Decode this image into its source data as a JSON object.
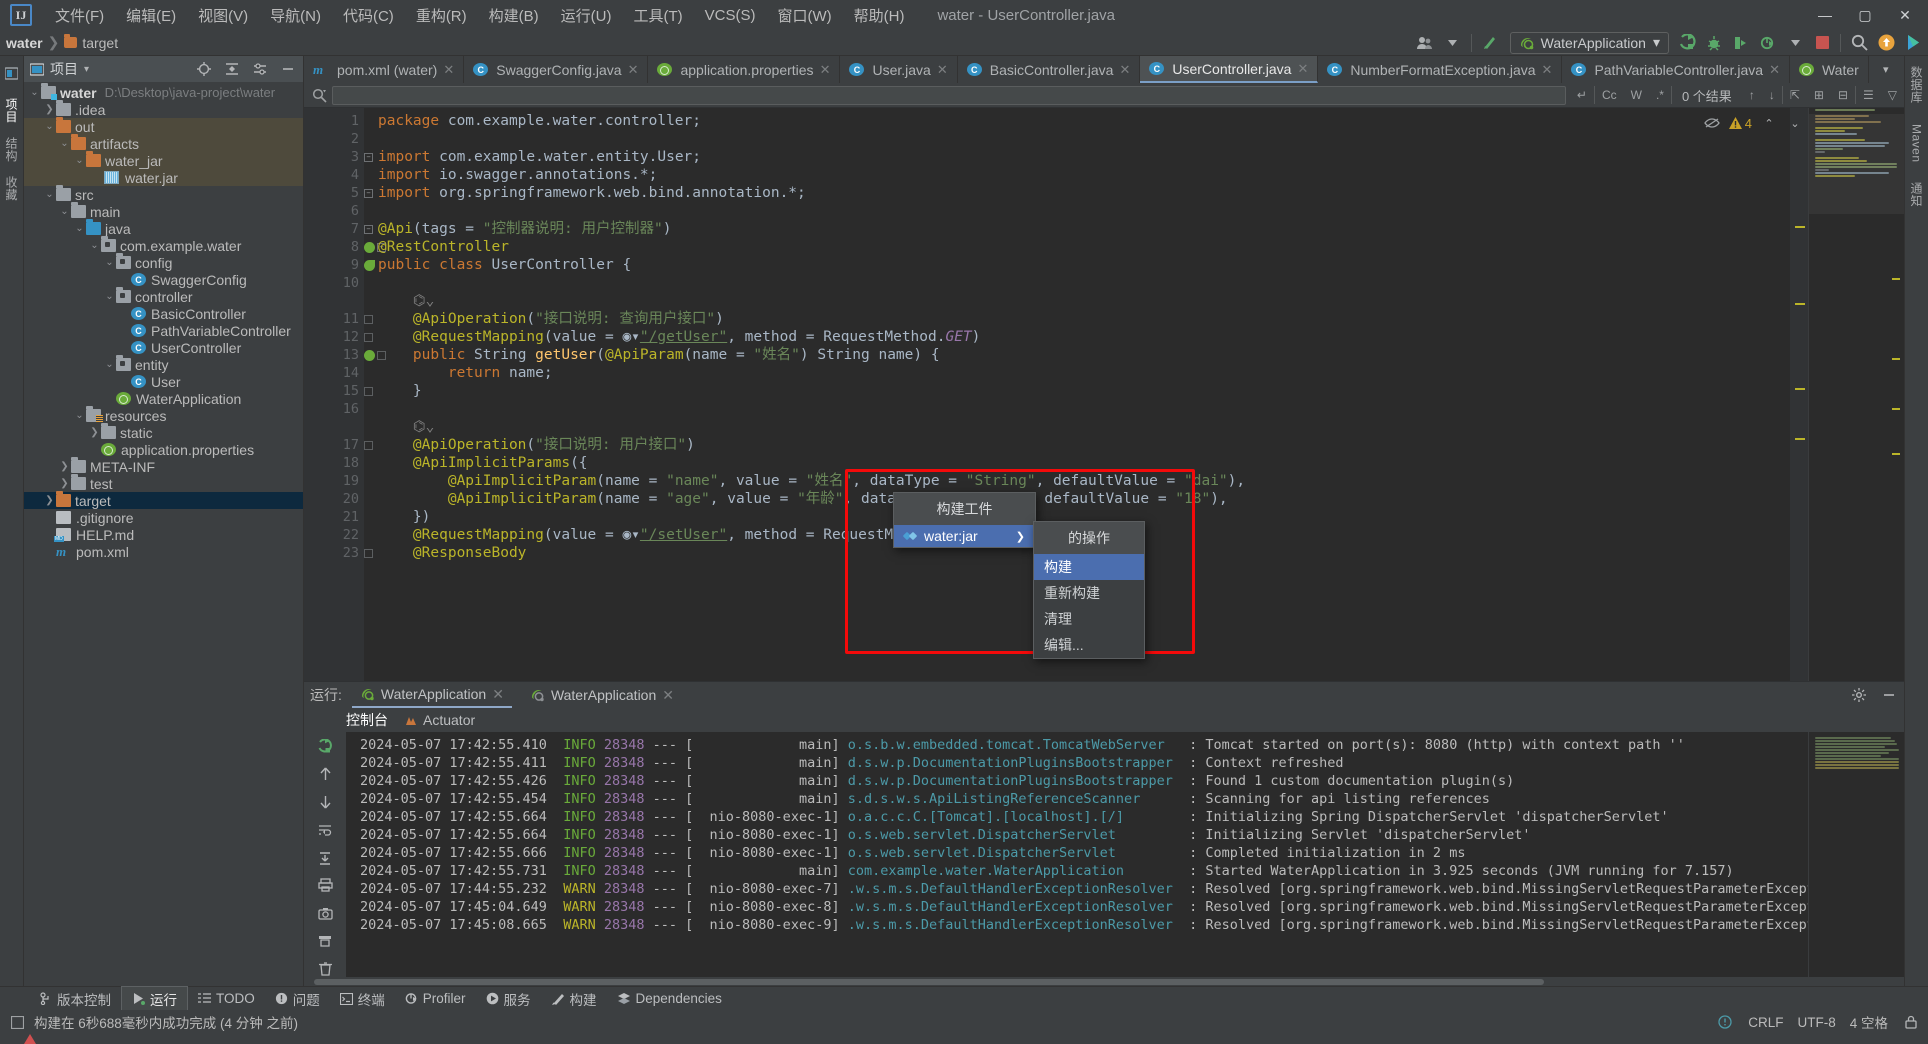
{
  "window": {
    "title": "water - UserController.java",
    "logo_text": "IJ",
    "controls": {
      "minimize": "—",
      "maximize": "▢",
      "close": "✕"
    }
  },
  "menubar": [
    {
      "label": "文件(F)"
    },
    {
      "label": "编辑(E)"
    },
    {
      "label": "视图(V)"
    },
    {
      "label": "导航(N)"
    },
    {
      "label": "代码(C)"
    },
    {
      "label": "重构(R)"
    },
    {
      "label": "构建(B)"
    },
    {
      "label": "运行(U)"
    },
    {
      "label": "工具(T)"
    },
    {
      "label": "VCS(S)"
    },
    {
      "label": "窗口(W)"
    },
    {
      "label": "帮助(H)"
    }
  ],
  "navbar": {
    "crumbs": [
      "water",
      "target"
    ],
    "separator": "❯",
    "run_config": "WaterApplication",
    "run_config_caret": "▾",
    "icons": [
      "user-group-icon",
      "caret-down-icon",
      "vcs-update-icon",
      "run-icon",
      "debug-icon",
      "run-with-coverage-icon",
      "profile-icon",
      "stop-icon",
      "search-everywhere-icon",
      "notifications-icon",
      "ide-assistant-icon"
    ]
  },
  "left_strip": {
    "tabs": [
      "项目",
      "结构",
      "收藏"
    ]
  },
  "right_strip": {
    "tabs": [
      "数据库",
      "Maven",
      "通知"
    ]
  },
  "project_panel": {
    "header_title": "项目",
    "header_caret": "▾",
    "header_icons": [
      "locate-icon",
      "collapse-all-icon",
      "settings-icon",
      "hide-icon"
    ],
    "tree": [
      {
        "depth": 0,
        "arrow": "v",
        "icon": "module-folder",
        "name": "water",
        "bold": true,
        "path": "D:\\Desktop\\java-project\\water",
        "state": "normal"
      },
      {
        "depth": 1,
        "arrow": ">",
        "icon": "folder",
        "name": ".idea",
        "state": "normal"
      },
      {
        "depth": 1,
        "arrow": "v",
        "icon": "folder-orange",
        "name": "out",
        "state": "highlight"
      },
      {
        "depth": 2,
        "arrow": "v",
        "icon": "folder-orange",
        "name": "artifacts",
        "state": "highlight"
      },
      {
        "depth": 3,
        "arrow": "v",
        "icon": "folder-orange",
        "name": "water_jar",
        "state": "highlight"
      },
      {
        "depth": 4,
        "arrow": "",
        "icon": "jar",
        "name": "water.jar",
        "state": "highlight"
      },
      {
        "depth": 1,
        "arrow": "v",
        "icon": "folder",
        "name": "src",
        "state": "normal"
      },
      {
        "depth": 2,
        "arrow": "v",
        "icon": "folder",
        "name": "main",
        "state": "normal"
      },
      {
        "depth": 3,
        "arrow": "v",
        "icon": "folder-blue",
        "name": "java",
        "state": "normal"
      },
      {
        "depth": 4,
        "arrow": "v",
        "icon": "package",
        "name": "com.example.water",
        "state": "normal"
      },
      {
        "depth": 5,
        "arrow": "v",
        "icon": "package",
        "name": "config",
        "state": "normal"
      },
      {
        "depth": 6,
        "arrow": "",
        "icon": "class",
        "name": "SwaggerConfig",
        "state": "normal"
      },
      {
        "depth": 5,
        "arrow": "v",
        "icon": "package",
        "name": "controller",
        "state": "normal"
      },
      {
        "depth": 6,
        "arrow": "",
        "icon": "class",
        "name": "BasicController",
        "state": "normal"
      },
      {
        "depth": 6,
        "arrow": "",
        "icon": "class",
        "name": "PathVariableController",
        "state": "normal"
      },
      {
        "depth": 6,
        "arrow": "",
        "icon": "class",
        "name": "UserController",
        "state": "normal"
      },
      {
        "depth": 5,
        "arrow": "v",
        "icon": "package",
        "name": "entity",
        "state": "normal"
      },
      {
        "depth": 6,
        "arrow": "",
        "icon": "class",
        "name": "User",
        "state": "normal"
      },
      {
        "depth": 5,
        "arrow": "",
        "icon": "spring",
        "name": "WaterApplication",
        "state": "normal"
      },
      {
        "depth": 3,
        "arrow": "v",
        "icon": "folder-res",
        "name": "resources",
        "state": "normal"
      },
      {
        "depth": 4,
        "arrow": ">",
        "icon": "folder",
        "name": "static",
        "state": "normal"
      },
      {
        "depth": 4,
        "arrow": "",
        "icon": "spring",
        "name": "application.properties",
        "state": "normal"
      },
      {
        "depth": 2,
        "arrow": ">",
        "icon": "folder",
        "name": "META-INF",
        "state": "normal"
      },
      {
        "depth": 2,
        "arrow": ">",
        "icon": "folder",
        "name": "test",
        "state": "normal"
      },
      {
        "depth": 1,
        "arrow": ">",
        "icon": "folder-orange",
        "name": "target",
        "state": "selected"
      },
      {
        "depth": 1,
        "arrow": "",
        "icon": "file",
        "name": ".gitignore",
        "state": "normal"
      },
      {
        "depth": 1,
        "arrow": "",
        "icon": "md",
        "name": "HELP.md",
        "state": "normal"
      },
      {
        "depth": 1,
        "arrow": "",
        "icon": "maven",
        "name": "pom.xml",
        "state": "normal"
      }
    ]
  },
  "editor": {
    "tabs": [
      {
        "label": "pom.xml (water)",
        "icon": "maven-icon",
        "active": false,
        "close": "✕"
      },
      {
        "label": "SwaggerConfig.java",
        "icon": "class-icon",
        "active": false,
        "close": "✕"
      },
      {
        "label": "application.properties",
        "icon": "spring-icon",
        "active": false,
        "close": "✕"
      },
      {
        "label": "User.java",
        "icon": "class-icon",
        "active": false,
        "close": "✕"
      },
      {
        "label": "BasicController.java",
        "icon": "class-icon",
        "active": false,
        "close": "✕"
      },
      {
        "label": "UserController.java",
        "icon": "class-icon",
        "active": true,
        "close": "✕"
      },
      {
        "label": "NumberFormatException.java",
        "icon": "class-icon",
        "active": false,
        "close": "✕"
      },
      {
        "label": "PathVariableController.java",
        "icon": "class-icon",
        "active": false,
        "close": "✕"
      },
      {
        "label": "Water",
        "icon": "spring-icon",
        "active": false,
        "close": ""
      }
    ],
    "tabs_overflow": "▾",
    "tabs_more": "⋮",
    "find_bar": {
      "placeholder": "",
      "value": "",
      "search_icon": "search-icon",
      "wrap_icon": "↵",
      "options": [
        "Cc",
        "W",
        ".*"
      ],
      "result_count": "0 个结果",
      "filter_icon": "filter-icon"
    },
    "inspection": {
      "warning_count": "4",
      "eye_icon": "eye-off-icon",
      "up": "⌃",
      "down": "⌄"
    },
    "code_lines": [
      {
        "n": 1,
        "fold": "",
        "mark": "",
        "html": "<span class='kw'>package</span> com.example.water.controller;"
      },
      {
        "n": 2,
        "fold": "",
        "mark": "",
        "html": ""
      },
      {
        "n": 3,
        "fold": "open",
        "mark": "",
        "html": "<span class='kw'>import</span> com.example.water.entity.User;"
      },
      {
        "n": 4,
        "fold": "",
        "mark": "",
        "html": "<span class='kw'>import</span> io.swagger.annotations.*;"
      },
      {
        "n": 5,
        "fold": "close",
        "mark": "",
        "html": "<span class='kw'>import</span> org.springframework.web.bind.annotation.*;"
      },
      {
        "n": 6,
        "fold": "",
        "mark": "",
        "html": ""
      },
      {
        "n": 7,
        "fold": "open",
        "mark": "",
        "html": "<span class='ann'>@Api</span>(tags = <span class='str'>\"控制器说明: 用户控制器\"</span>)"
      },
      {
        "n": 8,
        "fold": "close",
        "mark": "leaf",
        "html": "<span class='ann'>@RestController</span>"
      },
      {
        "n": 9,
        "fold": "",
        "mark": "leaf2",
        "html": "<span class='kw'>public class</span> UserController {"
      },
      {
        "n": 10,
        "fold": "",
        "mark": "",
        "html": ""
      },
      {
        "n": "",
        "fold": "",
        "mark": "",
        "html": "    <span class='cmt'>⌬⌄</span>"
      },
      {
        "n": 11,
        "fold": "bar",
        "mark": "",
        "html": "    <span class='ann'>@ApiOperation</span>(<span class='str'>\"接口说明: 查询用户接口\"</span>)"
      },
      {
        "n": 12,
        "fold": "bar",
        "mark": "",
        "html": "    <span class='ann'>@RequestMapping</span>(value = ◉▾<span class='lnk'>\"/getUser\"</span>, method = RequestMethod.<span class='ital'>GET</span>)"
      },
      {
        "n": 13,
        "fold": "bar",
        "mark": "spring",
        "html": "    <span class='kw'>public</span> String <span class='mth'>getUser</span>(<span class='ann'>@ApiParam</span>(name = <span class='str'>\"姓名\"</span>) String name) {"
      },
      {
        "n": 14,
        "fold": "",
        "mark": "",
        "html": "        <span class='kw'>return</span> name;"
      },
      {
        "n": 15,
        "fold": "bar",
        "mark": "",
        "html": "    }"
      },
      {
        "n": 16,
        "fold": "",
        "mark": "",
        "html": ""
      },
      {
        "n": "",
        "fold": "",
        "mark": "",
        "html": "    <span class='cmt'>⌬⌄</span>"
      },
      {
        "n": 17,
        "fold": "bar",
        "mark": "",
        "html": "    <span class='ann'>@ApiOperation</span>(<span class='str'>\"接口说明: 用户接口\"</span>)"
      },
      {
        "n": 18,
        "fold": "",
        "mark": "",
        "html": "    <span class='ann'>@ApiImplicitParams</span>({"
      },
      {
        "n": 19,
        "fold": "",
        "mark": "",
        "html": "        <span class='ann'>@ApiImplicitParam</span>(name = <span class='str'>\"name\"</span>, value = <span class='str'>\"姓名\"</span>, dataType = <span class='str'>\"String\"</span>, defaultValue = <span class='str'>\"dai\"</span>),"
      },
      {
        "n": 20,
        "fold": "",
        "mark": "",
        "html": "        <span class='ann'>@ApiImplicitParam</span>(name = <span class='str'>\"age\"</span>, value = <span class='str'>\"年龄\"</span>, dataType = <span class='str'>\"String\"</span>, defaultValue = <span class='str'>\"18\"</span>),"
      },
      {
        "n": 21,
        "fold": "",
        "mark": "",
        "html": "    })"
      },
      {
        "n": 22,
        "fold": "",
        "mark": "",
        "html": "    <span class='ann'>@RequestMapping</span>(value = ◉▾<span class='lnk'>\"/setUser\"</span>, method = RequestMethod.<span class='ital'>GET</span>)"
      },
      {
        "n": 23,
        "fold": "bar",
        "mark": "",
        "html": "    <span class='ann'>@ResponseBody</span>"
      }
    ]
  },
  "context_menu": {
    "primary": {
      "title": "构建工件",
      "items": [
        {
          "label": "water:jar",
          "icon": "artifact-icon",
          "selected": true,
          "chevron": "❯"
        }
      ]
    },
    "secondary": {
      "title": "的操作",
      "items": [
        {
          "label": "构建",
          "selected": true
        },
        {
          "label": "重新构建",
          "selected": false
        },
        {
          "label": "清理",
          "selected": false
        },
        {
          "label": "编辑...",
          "selected": false
        }
      ]
    }
  },
  "run_panel": {
    "label": "运行:",
    "tabs": [
      {
        "label": "WaterApplication",
        "icon": "spring-run-icon",
        "active": true,
        "close": "✕"
      },
      {
        "label": "WaterApplication",
        "icon": "spring-icon",
        "active": false,
        "close": "✕"
      }
    ],
    "header_icons": [
      "settings-icon",
      "hide-icon"
    ],
    "sub_tabs": [
      {
        "label": "控制台",
        "active": true,
        "icon": ""
      },
      {
        "label": "Actuator",
        "active": false,
        "icon": "actuator-icon"
      }
    ],
    "side_icons": [
      "rerun-icon",
      "scroll-up-icon",
      "scroll-down-icon",
      "soft-wrap-icon",
      "scroll-to-end-icon",
      "print-icon",
      "camera-icon",
      "clear-all-icon",
      "trash-icon"
    ],
    "console": [
      {
        "ts": "2024-05-07 17:42:55.410",
        "level": "INFO",
        "pid": "28348",
        "thread": "main",
        "cls": "o.s.b.w.embedded.tomcat.TomcatWebServer",
        "msg": "Tomcat started on port(s): 8080 (http) with context path ''"
      },
      {
        "ts": "2024-05-07 17:42:55.411",
        "level": "INFO",
        "pid": "28348",
        "thread": "main",
        "cls": "d.s.w.p.DocumentationPluginsBootstrapper",
        "msg": "Context refreshed"
      },
      {
        "ts": "2024-05-07 17:42:55.426",
        "level": "INFO",
        "pid": "28348",
        "thread": "main",
        "cls": "d.s.w.p.DocumentationPluginsBootstrapper",
        "msg": "Found 1 custom documentation plugin(s)"
      },
      {
        "ts": "2024-05-07 17:42:55.454",
        "level": "INFO",
        "pid": "28348",
        "thread": "main",
        "cls": "s.d.s.w.s.ApiListingReferenceScanner",
        "msg": "Scanning for api listing references"
      },
      {
        "ts": "2024-05-07 17:42:55.664",
        "level": "INFO",
        "pid": "28348",
        "thread": "nio-8080-exec-1",
        "cls": "o.a.c.c.C.[Tomcat].[localhost].[/]",
        "msg": "Initializing Spring DispatcherServlet 'dispatcherServlet'"
      },
      {
        "ts": "2024-05-07 17:42:55.664",
        "level": "INFO",
        "pid": "28348",
        "thread": "nio-8080-exec-1",
        "cls": "o.s.web.servlet.DispatcherServlet",
        "msg": "Initializing Servlet 'dispatcherServlet'"
      },
      {
        "ts": "2024-05-07 17:42:55.666",
        "level": "INFO",
        "pid": "28348",
        "thread": "nio-8080-exec-1",
        "cls": "o.s.web.servlet.DispatcherServlet",
        "msg": "Completed initialization in 2 ms"
      },
      {
        "ts": "2024-05-07 17:42:55.731",
        "level": "INFO",
        "pid": "28348",
        "thread": "main",
        "cls": "com.example.water.WaterApplication",
        "msg": "Started WaterApplication in 3.925 seconds (JVM running for 7.157)"
      },
      {
        "ts": "2024-05-07 17:44:55.232",
        "level": "WARN",
        "pid": "28348",
        "thread": "nio-8080-exec-7",
        "cls": ".w.s.m.s.DefaultHandlerExceptionResolver",
        "msg": "Resolved [org.springframework.web.bind.MissingServletRequestParameterException: Required request parameter 'name' for m"
      },
      {
        "ts": "2024-05-07 17:45:04.649",
        "level": "WARN",
        "pid": "28348",
        "thread": "nio-8080-exec-8",
        "cls": ".w.s.m.s.DefaultHandlerExceptionResolver",
        "msg": "Resolved [org.springframework.web.bind.MissingServletRequestParameterException: Required request parameter 'name' for m"
      },
      {
        "ts": "2024-05-07 17:45:08.665",
        "level": "WARN",
        "pid": "28348",
        "thread": "nio-8080-exec-9",
        "cls": ".w.s.m.s.DefaultHandlerExceptionResolver",
        "msg": "Resolved [org.springframework.web.bind.MissingServletRequestParameterException: Required request parameter 'name' for m"
      }
    ]
  },
  "bottom_tabs": [
    {
      "label": "版本控制",
      "icon": "vcs-icon",
      "active": false
    },
    {
      "label": "运行",
      "icon": "run-icon",
      "active": true
    },
    {
      "label": "TODO",
      "icon": "todo-icon",
      "active": false
    },
    {
      "label": "问题",
      "icon": "problems-icon",
      "active": false
    },
    {
      "label": "终端",
      "icon": "terminal-icon",
      "active": false
    },
    {
      "label": "Profiler",
      "icon": "profiler-icon",
      "active": false
    },
    {
      "label": "服务",
      "icon": "services-icon",
      "active": false
    },
    {
      "label": "构建",
      "icon": "build-icon",
      "active": false
    },
    {
      "label": "Dependencies",
      "icon": "dependencies-icon",
      "active": false
    }
  ],
  "status_bar": {
    "icon": "build-status-icon",
    "message": "构建在 6秒688毫秒内成功完成 (4 分钟 之前)",
    "right": {
      "line_sep": "CRLF",
      "encoding": "UTF-8",
      "indent": "4 空格",
      "lock_icon": "lock-icon",
      "notification_icon": "notification-icon"
    }
  },
  "colors": {
    "bg_panel": "#3c3f41",
    "bg_editor": "#2b2b2b",
    "accent_select": "#4b6eaf",
    "accent_highlight": "#f40a0a",
    "tree_selected": "#0d293e",
    "tree_highlight": "#4e4a3c",
    "green": "#6aab3a",
    "orange": "#c8763c",
    "blue": "#3592c4"
  }
}
